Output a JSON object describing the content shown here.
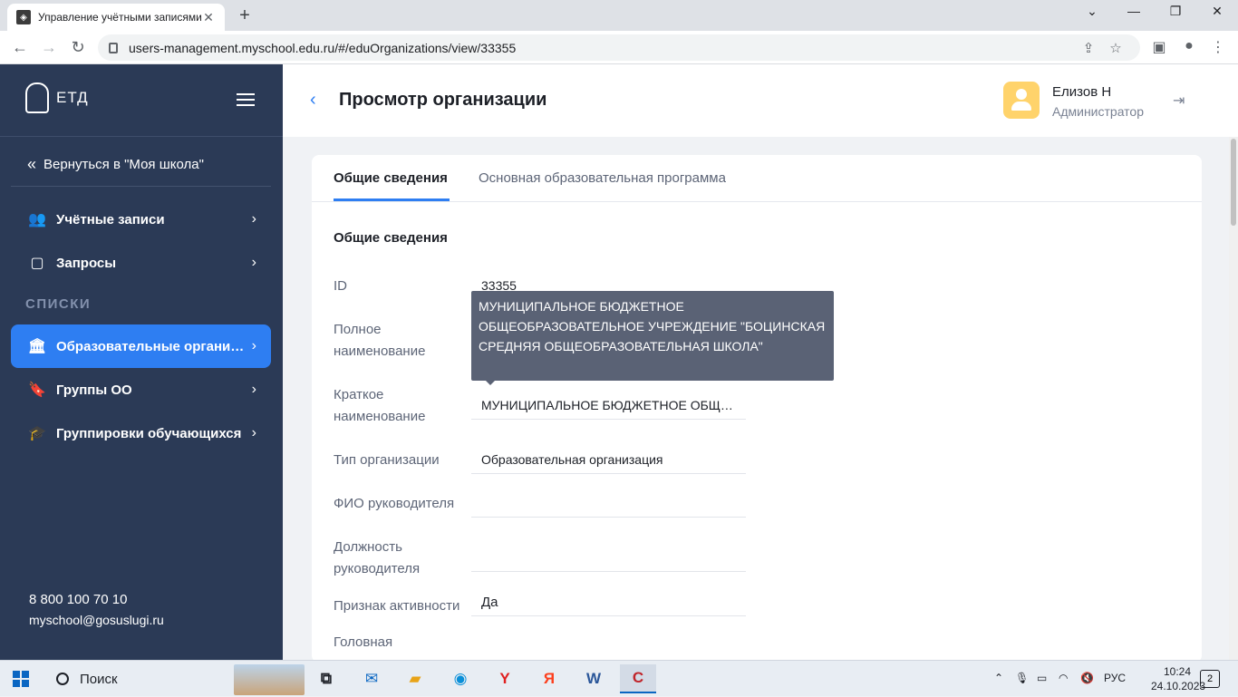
{
  "browser": {
    "tab_title": "Управление учётными записями",
    "tab_close": "✕",
    "new_tab": "+",
    "url": "users-management.myschool.edu.ru/#/eduOrganizations/view/33355",
    "win_minimize": "⌄",
    "win_min2": "—",
    "win_restore": "❐",
    "win_close": "✕"
  },
  "sidebar": {
    "logo_text": "ЕТД",
    "back_link": "Вернуться в \"Моя школа\"",
    "items": [
      {
        "label": "Учётные записи",
        "icon": "users-icon"
      },
      {
        "label": "Запросы",
        "icon": "inbox-icon"
      }
    ],
    "section_label": "СПИСКИ",
    "list_items": [
      {
        "label": "Образовательные организации",
        "icon": "institution-icon",
        "active": true
      },
      {
        "label": "Группы ОО",
        "icon": "bookmark-icon"
      },
      {
        "label": "Группировки обучающихся",
        "icon": "graduation-cap-icon"
      }
    ],
    "phone": "8 800 100 70 10",
    "email": "myschool@gosuslugi.ru"
  },
  "header": {
    "title": "Просмотр организации",
    "user_name": "Елизов Н",
    "user_role": "Администратор"
  },
  "tabs": [
    {
      "label": "Общие сведения",
      "active": true
    },
    {
      "label": "Основная образовательная программа",
      "active": false
    }
  ],
  "section_title": "Общие сведения",
  "fields": {
    "id_label": "ID",
    "id_value": "33355",
    "full_name_label": "Полное наименование",
    "short_name_label": "Краткое наименование",
    "short_name_value": "МУНИЦИПАЛЬНОЕ БЮДЖЕТНОЕ ОБЩЕОБРАЗОВАТЕЛЬНОЕ УЧРЕЖДЕНИЕ",
    "org_type_label": "Тип организации",
    "org_type_value": "Образовательная организация",
    "head_name_label": "ФИО руководителя",
    "head_name_value": "",
    "head_position_label": "Должность руководителя",
    "head_position_value": "",
    "active_label": "Признак активности",
    "active_value": "Да",
    "parent_label": "Головная"
  },
  "tooltip": "МУНИЦИПАЛЬНОЕ БЮДЖЕТНОЕ ОБЩЕОБРАЗОВАТЕЛЬНОЕ УЧРЕЖДЕНИЕ \"БОЦИНСКАЯ СРЕДНЯЯ ОБЩЕОБРАЗОВАТЕЛЬНАЯ ШКОЛА\"",
  "taskbar": {
    "search_label": "Поиск",
    "lang": "РУС",
    "time": "10:24",
    "date": "24.10.2023",
    "notifications": "2"
  },
  "colors": {
    "sidebar_bg": "#2b3a56",
    "accent": "#2e7ef2",
    "avatar": "#ffd36b"
  }
}
